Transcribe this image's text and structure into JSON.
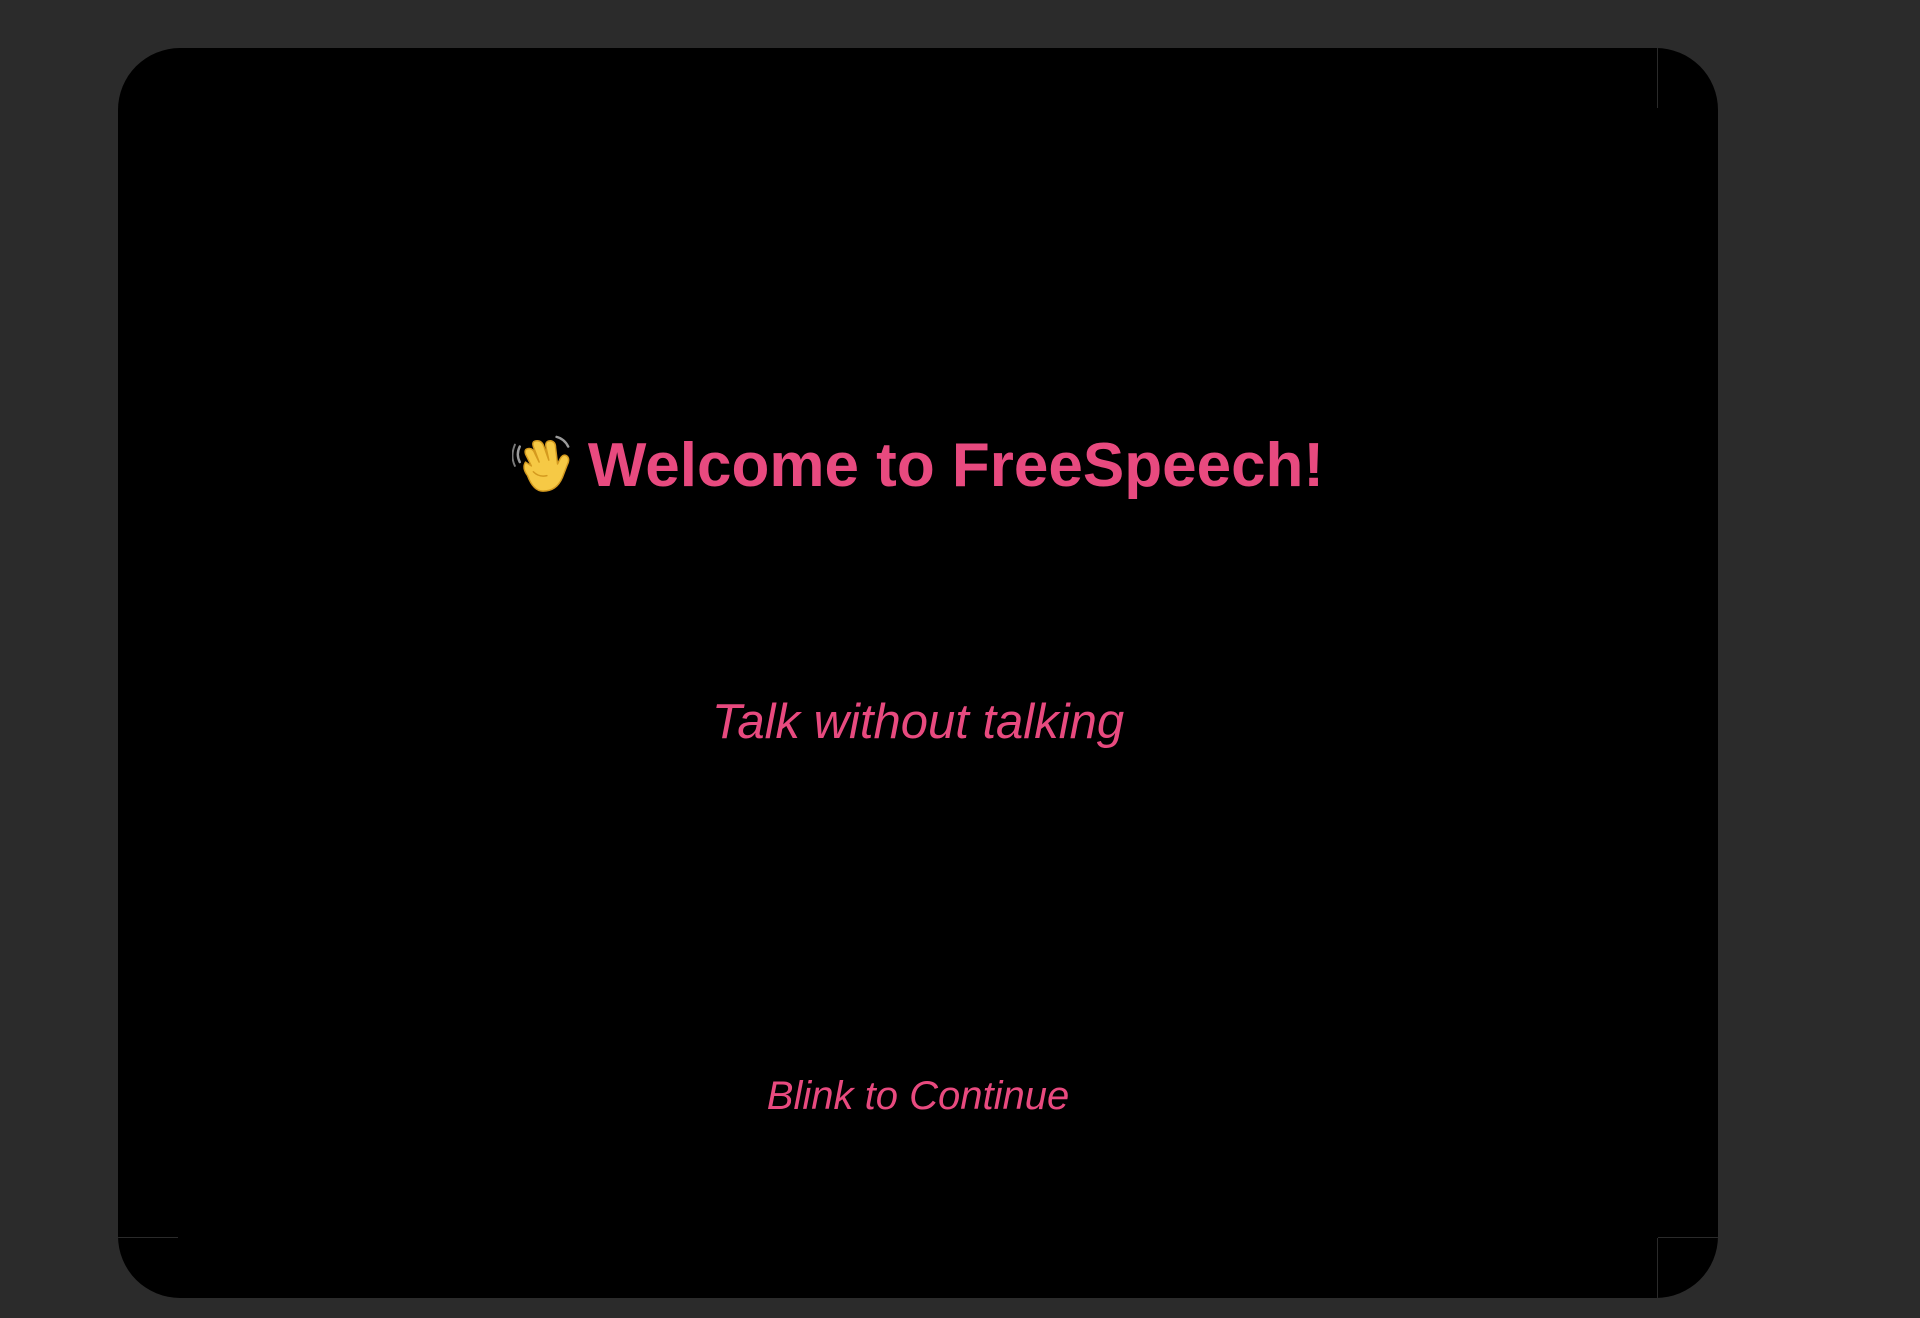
{
  "welcome": {
    "icon": "waving-hand-icon",
    "title": "Welcome to FreeSpeech!",
    "subtitle": "Talk without talking",
    "continue_prompt": "Blink to Continue"
  },
  "colors": {
    "background": "#000000",
    "accent": "#e84a7f",
    "desktop": "#2b2b2b"
  }
}
